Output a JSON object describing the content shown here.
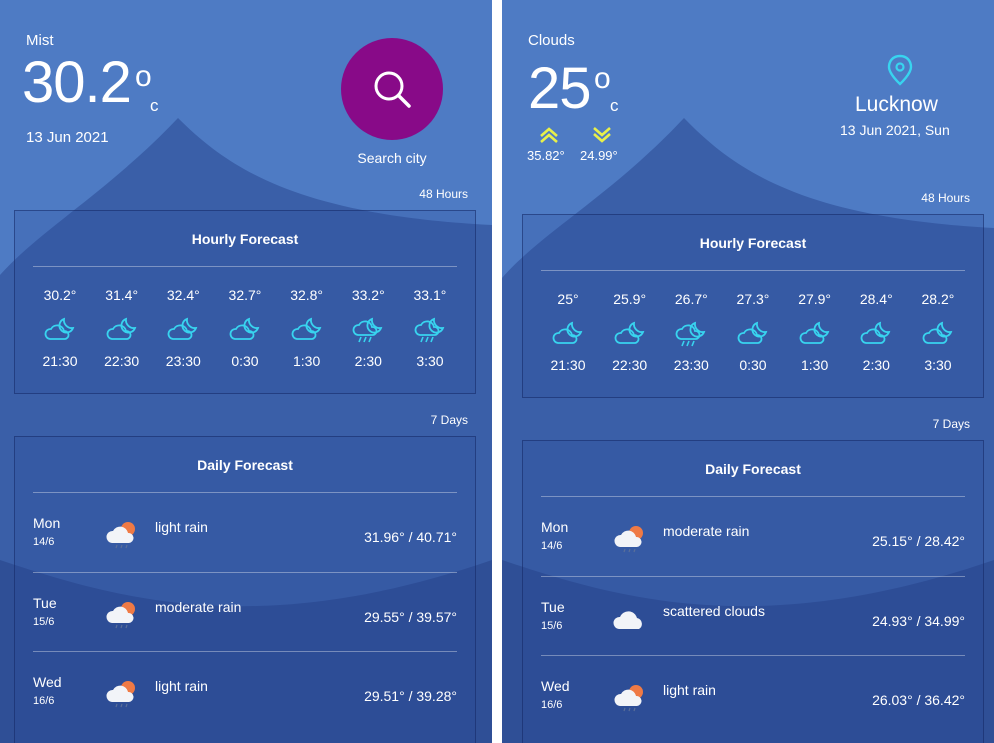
{
  "left": {
    "condition": "Mist",
    "temperature": "30.2",
    "degree_symbol": "o",
    "unit": "c",
    "date": "13 Jun  2021",
    "search_label": "Search city",
    "hourly_badge": "48 Hours",
    "hourly_title": "Hourly Forecast",
    "hourly": [
      {
        "temp": "30.2°",
        "time": "21:30",
        "icon": "cloud-moon-icon"
      },
      {
        "temp": "31.4°",
        "time": "22:30",
        "icon": "cloud-moon-icon"
      },
      {
        "temp": "32.4°",
        "time": "23:30",
        "icon": "cloud-moon-icon"
      },
      {
        "temp": "32.7°",
        "time": "0:30",
        "icon": "cloud-moon-icon"
      },
      {
        "temp": "32.8°",
        "time": "1:30",
        "icon": "cloud-moon-icon"
      },
      {
        "temp": "33.2°",
        "time": "2:30",
        "icon": "cloud-moon-rain-icon"
      },
      {
        "temp": "33.1°",
        "time": "3:30",
        "icon": "cloud-moon-rain-icon"
      }
    ],
    "daily_badge": "7 Days",
    "daily_title": "Daily Forecast",
    "daily": [
      {
        "day": "Mon",
        "date": "14/6",
        "desc": "light rain",
        "range": "31.96° / 40.71°",
        "icon": "sun-cloud-rain-icon"
      },
      {
        "day": "Tue",
        "date": "15/6",
        "desc": "moderate rain",
        "range": "29.55° / 39.57°",
        "icon": "sun-cloud-rain-icon"
      },
      {
        "day": "Wed",
        "date": "16/6",
        "desc": "light rain",
        "range": "29.51° / 39.28°",
        "icon": "sun-cloud-rain-icon"
      }
    ]
  },
  "right": {
    "condition": "Clouds",
    "temperature": "25",
    "degree_symbol": "o",
    "unit": "c",
    "high": "35.82°",
    "low": "24.99°",
    "location": "Lucknow",
    "date": "13 Jun  2021, Sun",
    "hourly_badge": "48 Hours",
    "hourly_title": "Hourly Forecast",
    "hourly": [
      {
        "temp": "25°",
        "time": "21:30",
        "icon": "cloud-moon-icon"
      },
      {
        "temp": "25.9°",
        "time": "22:30",
        "icon": "cloud-moon-icon"
      },
      {
        "temp": "26.7°",
        "time": "23:30",
        "icon": "cloud-moon-rain-icon"
      },
      {
        "temp": "27.3°",
        "time": "0:30",
        "icon": "cloud-moon-icon"
      },
      {
        "temp": "27.9°",
        "time": "1:30",
        "icon": "cloud-moon-icon"
      },
      {
        "temp": "28.4°",
        "time": "2:30",
        "icon": "cloud-moon-icon"
      },
      {
        "temp": "28.2°",
        "time": "3:30",
        "icon": "cloud-moon-icon"
      }
    ],
    "daily_badge": "7 Days",
    "daily_title": "Daily Forecast",
    "daily": [
      {
        "day": "Mon",
        "date": "14/6",
        "desc": "moderate rain",
        "range": "25.15° / 28.42°",
        "icon": "sun-cloud-rain-icon"
      },
      {
        "day": "Tue",
        "date": "15/6",
        "desc": "scattered clouds",
        "range": "24.93° / 34.99°",
        "icon": "cloud-icon"
      },
      {
        "day": "Wed",
        "date": "16/6",
        "desc": "light rain",
        "range": "26.03° / 36.42°",
        "icon": "sun-cloud-rain-icon"
      }
    ]
  },
  "colors": {
    "background": "#4a76bf",
    "mountain_dark": "#34579e",
    "search_button": "#880a88",
    "accent_cyan": "#38d4ef",
    "accent_yellow": "#e8f04a"
  }
}
